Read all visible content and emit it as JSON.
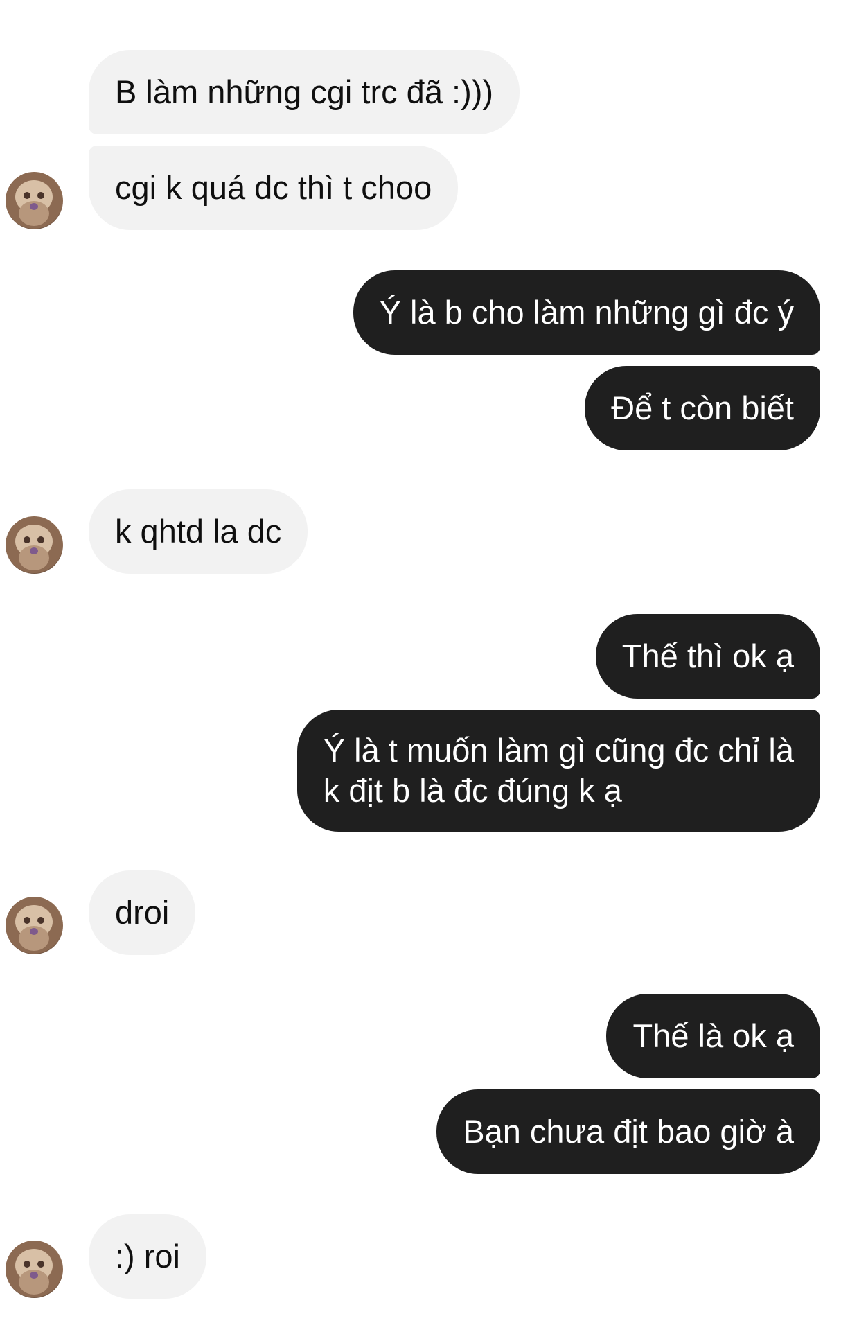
{
  "messages": [
    {
      "from": "other",
      "text": "B làm những cgi trc đã :)))"
    },
    {
      "from": "other",
      "text": "cgi k quá dc thì t choo"
    },
    {
      "from": "me",
      "text": "Ý là b cho làm những gì đc ý"
    },
    {
      "from": "me",
      "text": "Để t còn biết"
    },
    {
      "from": "other",
      "text": "k qhtd la dc"
    },
    {
      "from": "me",
      "text": "Thế thì ok ạ"
    },
    {
      "from": "me",
      "text": "Ý là t muốn làm gì cũng đc chỉ là\nk địt b là đc đúng k ạ"
    },
    {
      "from": "other",
      "text": "droi"
    },
    {
      "from": "me",
      "text": "Thế là ok ạ"
    },
    {
      "from": "me",
      "text": "Bạn chưa địt bao giờ à"
    },
    {
      "from": "other",
      "text": ":) roi"
    }
  ],
  "colors": {
    "received_bubble": "#f2f2f2",
    "sent_bubble": "#1f1f1f",
    "received_text": "#0f0f0f",
    "sent_text": "#ffffff"
  },
  "icons": {
    "avatar": "contact-avatar-icon"
  }
}
